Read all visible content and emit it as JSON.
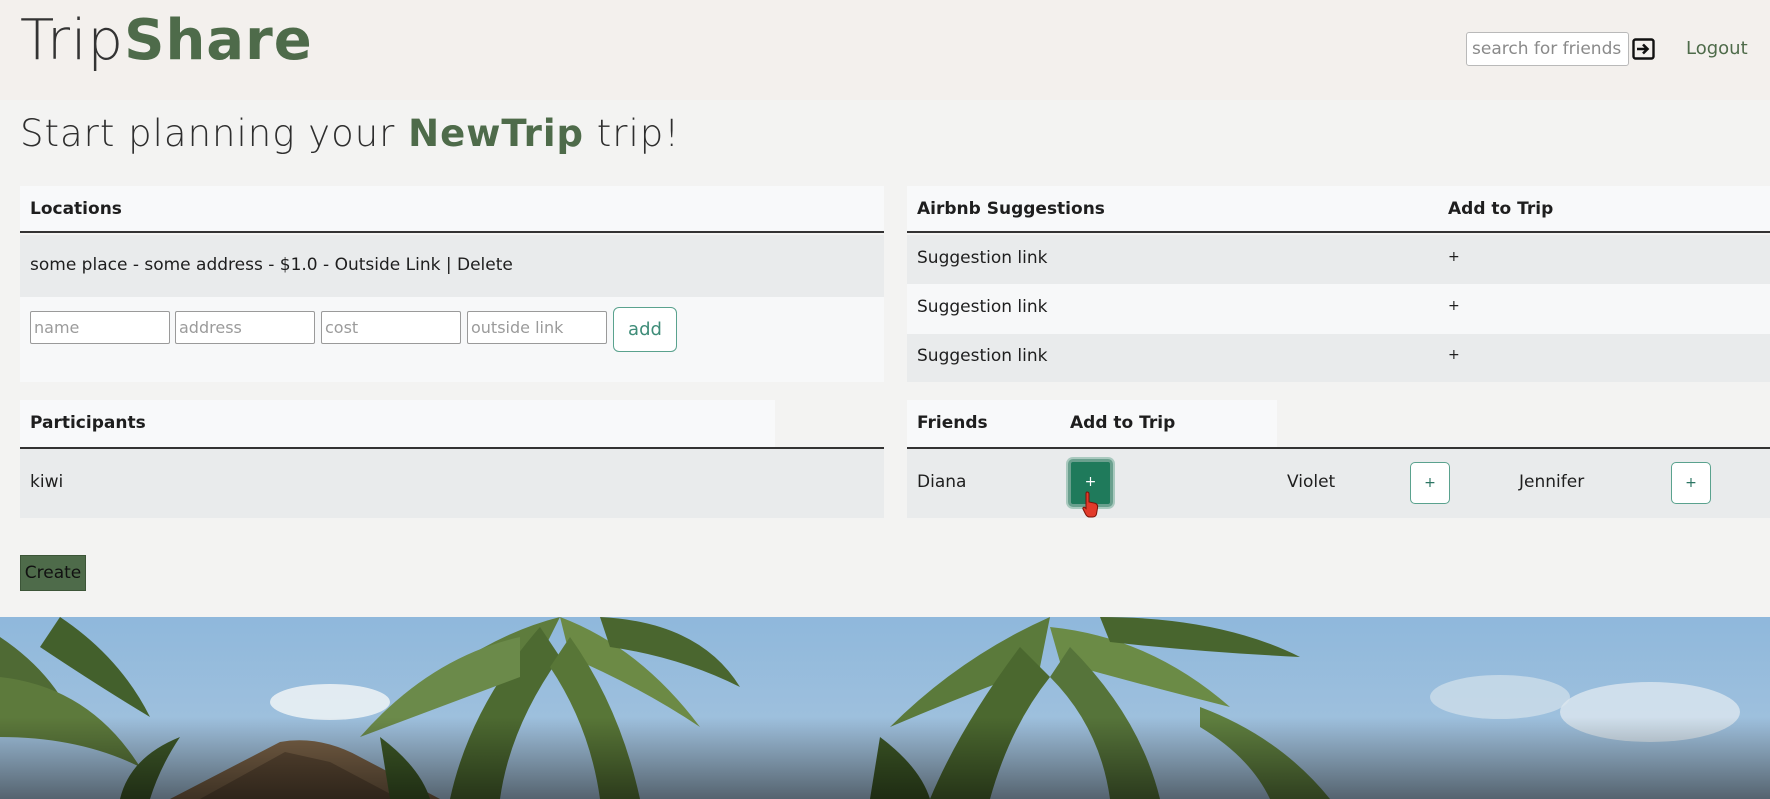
{
  "header": {
    "logo_part1": "Trip",
    "logo_part2": "Share",
    "search_placeholder": "search for friends",
    "search_icon": "enter-arrow-icon",
    "logout": "Logout"
  },
  "page_title": {
    "prefix": "Start planning your",
    "trip_name": "NewTrip",
    "suffix": "trip!"
  },
  "locations": {
    "header": "Locations",
    "rows": [
      {
        "text": "some place - some address - $1.0 - ",
        "link": "Outside Link",
        "separator": " | ",
        "delete": "Delete"
      }
    ],
    "inputs": {
      "name_placeholder": "name",
      "address_placeholder": "address",
      "cost_placeholder": "cost",
      "link_placeholder": "outside link"
    },
    "add_label": "add"
  },
  "airbnb": {
    "header": "Airbnb Suggestions",
    "add_header": "Add to Trip",
    "rows": [
      {
        "label": "Suggestion link",
        "add": "+"
      },
      {
        "label": "Suggestion link",
        "add": "+"
      },
      {
        "label": "Suggestion link",
        "add": "+"
      }
    ]
  },
  "participants": {
    "header": "Participants",
    "rows": [
      {
        "name": "kiwi"
      }
    ]
  },
  "friends": {
    "header": "Friends",
    "add_header": "Add to Trip",
    "items": [
      {
        "name": "Diana",
        "add": "+",
        "state": "pressed"
      },
      {
        "name": "Violet",
        "add": "+"
      },
      {
        "name": "Jennifer",
        "add": "+"
      }
    ]
  },
  "create_label": "Create",
  "colors": {
    "brand_green": "#4e6b4a",
    "accent_teal": "#1f7a5b",
    "header_bg": "#f3f0ed",
    "page_bg": "#f3f3f2"
  }
}
